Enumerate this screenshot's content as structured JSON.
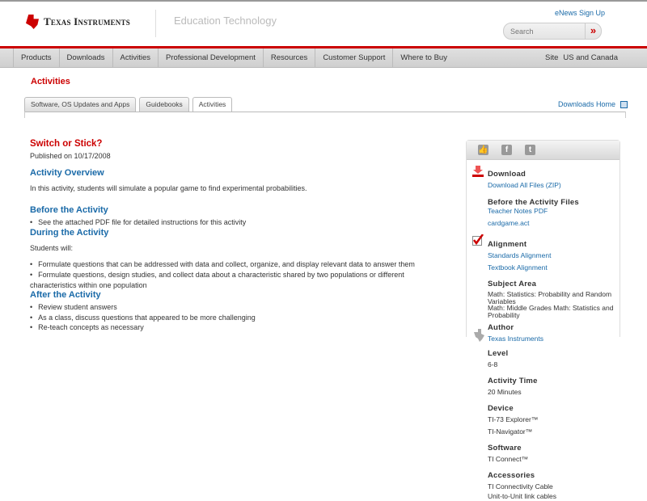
{
  "header": {
    "brand": "Texas Instruments",
    "section": "Education Technology",
    "enews": "eNews Sign Up",
    "search_placeholder": "Search",
    "search_go": "»"
  },
  "nav": {
    "items": [
      "Products",
      "Downloads",
      "Activities",
      "Professional Development",
      "Resources",
      "Customer Support",
      "Where to Buy"
    ],
    "site_label": "Site",
    "site_value": "US and Canada"
  },
  "page_title": "Activities",
  "tabs": [
    "Software, OS Updates and Apps",
    "Guidebooks",
    "Activities"
  ],
  "downloads_home": "Downloads Home",
  "activity": {
    "title": "Switch or Stick?",
    "published": "Published on 10/17/2008",
    "overview_h": "Activity Overview",
    "overview": "In this activity, students will simulate a popular game to find experimental probabilities.",
    "before_h": "Before the Activity",
    "before": [
      "See the attached PDF file for detailed instructions for this activity"
    ],
    "during_h": "During the Activity",
    "during_intro": "Students will:",
    "during": [
      "Formulate questions that can be addressed with data and collect, organize, and display relevant data to answer them",
      "Formulate questions, design studies, and collect data about a characteristic shared by two populations or different characteristics within one population"
    ],
    "after_h": "After the Activity",
    "after": [
      "Review student answers",
      "As a class, discuss questions that appeared to be more challenging",
      "Re-teach concepts as necessary"
    ]
  },
  "sidebar": {
    "download_h": "Download",
    "download_all": "Download All Files (ZIP)",
    "before_files_h": "Before the Activity Files",
    "teacher_notes": "Teacher Notes PDF",
    "cardgame": "cardgame.act",
    "alignment_h": "Alignment",
    "standards": "Standards Alignment",
    "textbook": "Textbook Alignment",
    "subject_h": "Subject Area",
    "subject1": "Math: Statistics: Probability and Random Variables",
    "subject2": "Math: Middle Grades Math: Statistics and Probability",
    "author_h": "Author",
    "author": "Texas Instruments",
    "level_h": "Level",
    "level": "6-8",
    "time_h": "Activity Time",
    "time": "20 Minutes",
    "device_h": "Device",
    "device1": "TI-73 Explorer™",
    "device2": "TI-Navigator™",
    "software_h": "Software",
    "software": "TI Connect™",
    "acc_h": "Accessories",
    "acc1": "TI Connectivity Cable",
    "acc2": "Unit-to-Unit link cables"
  }
}
